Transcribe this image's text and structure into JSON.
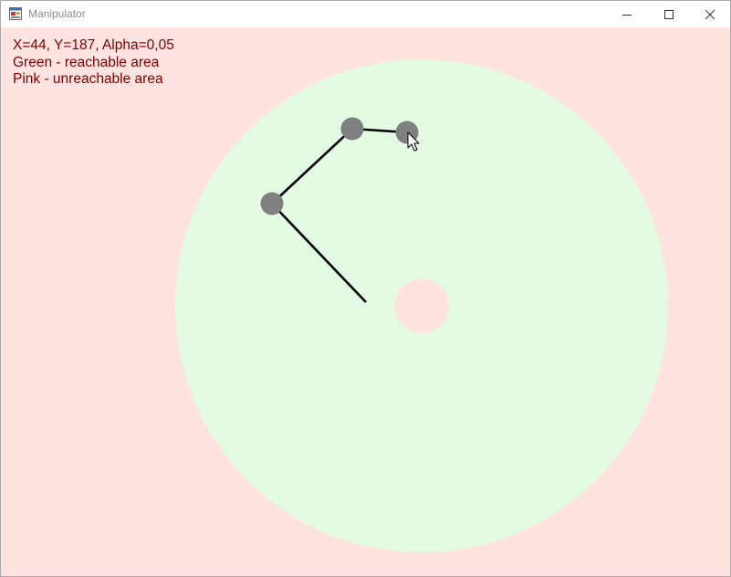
{
  "window": {
    "title": "Manipulator",
    "icon": "winforms-app-icon"
  },
  "titlebar_controls": {
    "minimize_icon": "minimize-icon",
    "maximize_icon": "maximize-icon",
    "close_icon": "close-icon"
  },
  "info": {
    "coords_line": "X=44, Y=187, Alpha=0,05",
    "green_legend": "Green - reachable area",
    "pink_legend": "Pink - unreachable area",
    "text_color": "#800000"
  },
  "colors": {
    "unreachable": "#ffe3e1",
    "reachable": "#e2fbe2",
    "joint": "#808080",
    "link": "#000000"
  },
  "cursor_icon": "arrow-cursor-icon"
}
